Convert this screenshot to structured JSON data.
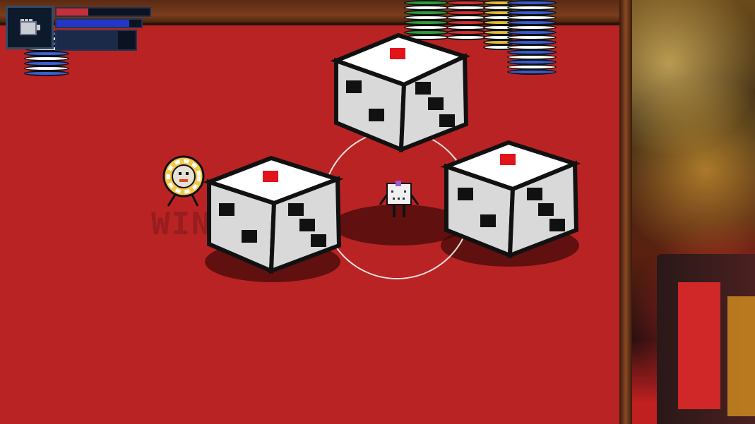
{
  "hud": {
    "portrait_icon": "fist-icon",
    "health_fraction": 0.34,
    "mana_fraction": 0.86,
    "stamina_fraction": 0.78,
    "colors": {
      "health": "#c62f3a",
      "mana": "#2436c8",
      "stamina": "#1b2a48"
    }
  },
  "table": {
    "felt_color": "#b92324",
    "rim_color": "#6a3418"
  },
  "dice": [
    {
      "id": "die-top",
      "top_pip_color": "#e0141a"
    },
    {
      "id": "die-left",
      "top_pip_color": "#e0141a"
    },
    {
      "id": "die-right",
      "top_pip_color": "#e0141a"
    }
  ],
  "enemy": {
    "name": "poker-chip-enemy",
    "chip_color": "#f2c94c"
  },
  "player": {
    "name": "dice-cube-player",
    "gem_color": "#9b5bd4"
  },
  "ghost_text": "WIN! 4"
}
